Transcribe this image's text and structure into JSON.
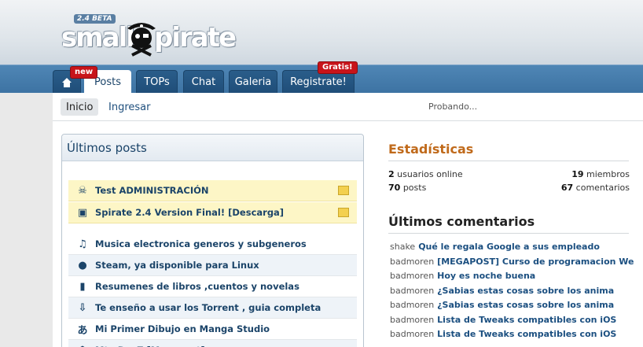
{
  "header": {
    "logo_badge": "2.4 BETA",
    "logo_left": "small",
    "logo_right": "pirate"
  },
  "nav": {
    "tabs": [
      {
        "label": ""
      },
      {
        "label": "Posts"
      },
      {
        "label": "TOPs"
      },
      {
        "label": "Chat"
      },
      {
        "label": "Galeria"
      },
      {
        "label": "Registrate!"
      }
    ],
    "badge_new": "new",
    "badge_gratis": "Gratis!"
  },
  "subnav": {
    "inicio": "Inicio",
    "ingresar": "Ingresar",
    "status": "Probando..."
  },
  "posts": {
    "title": "Últimos posts",
    "items": [
      {
        "title": "Test ADMINISTRACIÓN",
        "icon": "skull-icon",
        "glyph": "☠",
        "sticky": true
      },
      {
        "title": "Spirate 2.4 Version Final! [Descarga]",
        "icon": "floppy-icon",
        "glyph": "▣",
        "sticky": true
      },
      {
        "title": "Musica electronica generos y subgeneros",
        "icon": "music-note-icon",
        "glyph": "♫",
        "sticky": false
      },
      {
        "title": "Steam, ya disponible para Linux",
        "icon": "linux-penguin-icon",
        "glyph": "●",
        "sticky": false
      },
      {
        "title": "Resumenes de libros ,cuentos y novelas",
        "icon": "book-icon",
        "glyph": "▮",
        "sticky": false
      },
      {
        "title": "Te enseño a usar los Torrent , guia completa",
        "icon": "download-icon",
        "glyph": "⇩",
        "sticky": false
      },
      {
        "title": "Mi Primer Dibujo en Manga Studio",
        "icon": "hiragana-icon",
        "glyph": "あ",
        "sticky": false
      },
      {
        "title": "Mta DayZ [Megapost]",
        "icon": "game-invader-icon",
        "glyph": "☗",
        "sticky": false
      }
    ]
  },
  "stats": {
    "title": "Estadísticas",
    "users_online_num": "2",
    "users_online_label": "usuarios online",
    "members_num": "19",
    "members_label": "miembros",
    "posts_num": "70",
    "posts_label": "posts",
    "comments_num": "67",
    "comments_label": "comentarios"
  },
  "comments": {
    "title": "Últimos comentarios",
    "items": [
      {
        "user": "shake",
        "title": "Qué le regala Google a sus empleado"
      },
      {
        "user": "badmoren",
        "title": "[MEGAPOST] Curso de programacion We"
      },
      {
        "user": "badmoren",
        "title": "Hoy es noche buena"
      },
      {
        "user": "badmoren",
        "title": "¿Sabias estas cosas sobre los anima"
      },
      {
        "user": "badmoren",
        "title": "¿Sabias estas cosas sobre los anima"
      },
      {
        "user": "badmoren",
        "title": "Lista de Tweaks compatibles con iOS"
      },
      {
        "user": "badmoren",
        "title": "Lista de Tweaks compatibles con iOS"
      }
    ]
  },
  "colors": {
    "nav_blue": "#3d73a3",
    "tab_dark": "#1f4d78",
    "stats_orange": "#c06a1b",
    "sticky_yellow": "#fdf6c6",
    "badge_red": "#c8141a"
  }
}
